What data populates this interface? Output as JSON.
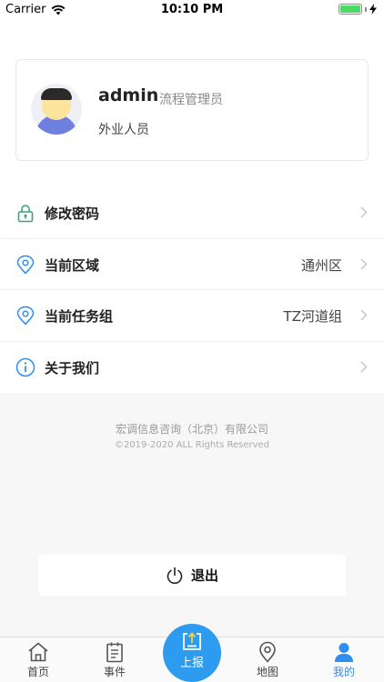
{
  "status_bar": {
    "carrier": "Carrier",
    "time": "10:10 PM"
  },
  "profile": {
    "username": "admin",
    "role": "流程管理员",
    "user_type": "外业人员"
  },
  "menu": {
    "items": [
      {
        "label": "修改密码",
        "value": "",
        "icon": "lock-icon"
      },
      {
        "label": "当前区域",
        "value": "通州区",
        "icon": "location-pin-icon"
      },
      {
        "label": "当前任务组",
        "value": "TZ河道组",
        "icon": "location-pin-icon"
      },
      {
        "label": "关于我们",
        "value": "",
        "icon": "info-icon"
      }
    ]
  },
  "footer": {
    "company": "宏调信息咨询（北京）有限公司",
    "copyright": "©2019-2020 ALL Rights Reserved"
  },
  "logout": {
    "label": "退出"
  },
  "tabbar": {
    "tabs": [
      {
        "label": "首页",
        "icon": "home-icon"
      },
      {
        "label": "事件",
        "icon": "clipboard-icon"
      },
      {
        "label": "上报",
        "icon": "upload-icon"
      },
      {
        "label": "地图",
        "icon": "map-pin-icon"
      },
      {
        "label": "我的",
        "icon": "user-icon"
      }
    ],
    "active": "我的"
  },
  "colors": {
    "accent": "#2d8ff0",
    "icon_green": "#3ba37a",
    "icon_blue": "#2d8ff0",
    "report_button": "#2d9cf0",
    "battery": "#4cd964"
  }
}
